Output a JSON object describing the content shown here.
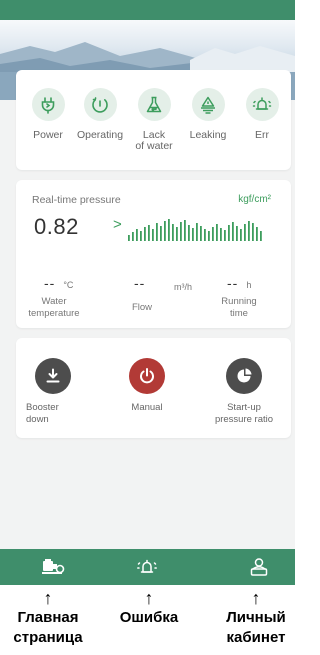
{
  "status": {
    "items": [
      {
        "label": "Power",
        "icon": "power-plug-icon"
      },
      {
        "label": "Operating",
        "icon": "operating-gauge-icon"
      },
      {
        "label": "Lack\nof water",
        "icon": "flask-icon"
      },
      {
        "label": "Leaking",
        "icon": "leaking-drop-icon"
      },
      {
        "label": "Err",
        "icon": "alarm-bell-icon"
      }
    ]
  },
  "pressure": {
    "title": "Real-time pressure",
    "unit": "kgf/cm²",
    "value": "0.82",
    "chevron": ">",
    "temperature": {
      "value": "--",
      "unit": "°C",
      "label": "Water\ntemperature"
    },
    "flow": {
      "value": "--",
      "unit": "m³/h",
      "label": "Flow"
    },
    "running": {
      "value": "--",
      "unit": "h",
      "label": "Running\ntime"
    }
  },
  "controls": {
    "booster": {
      "label": "Booster\ndown",
      "icon": "download-icon",
      "color": "#4d4d4d"
    },
    "manual": {
      "label": "Manual",
      "icon": "power-icon",
      "color": "#b23a36"
    },
    "startup": {
      "label": "Start-up\npressure ratio",
      "icon": "pie-chart-icon",
      "color": "#4d4d4d"
    }
  },
  "nav": {
    "items": [
      {
        "icon": "pump-icon"
      },
      {
        "icon": "alarm-bell-icon"
      },
      {
        "icon": "user-profile-icon"
      }
    ]
  },
  "annotations": [
    {
      "arrow": "↑",
      "text": "Главная\nстраница"
    },
    {
      "arrow": "↑",
      "text": "Ошибка"
    },
    {
      "arrow": "↑",
      "text": "Личный\nкабинет"
    }
  ],
  "colors": {
    "brand": "#3f8e6b",
    "accent": "#3d9d5d",
    "icon_bg": "#e4efe8",
    "manual_red": "#b23a36"
  }
}
